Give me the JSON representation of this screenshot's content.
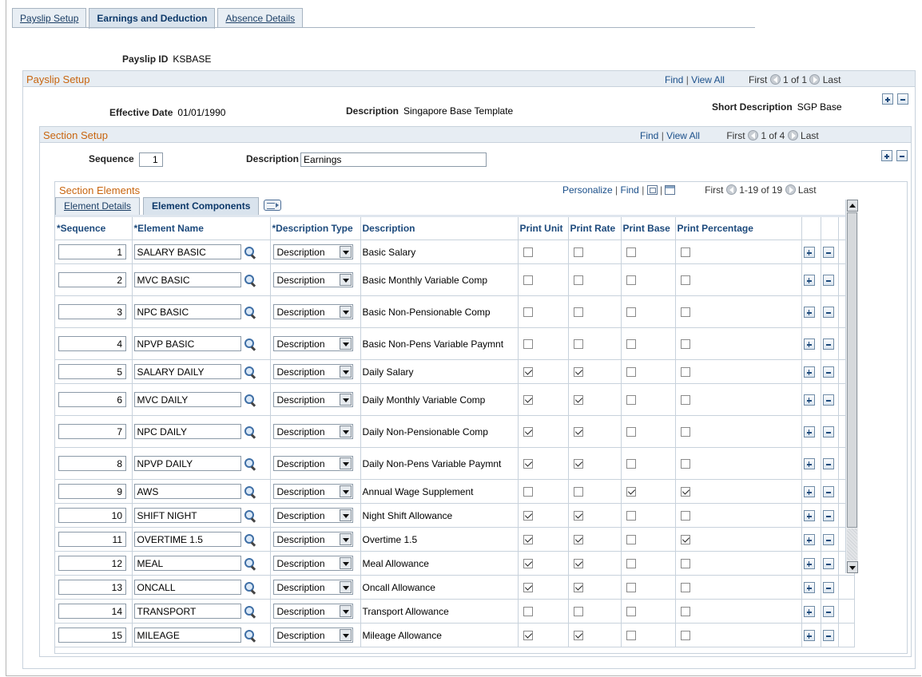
{
  "tabs": [
    {
      "pre": "",
      "u": "P",
      "post": "ayslip Setup"
    },
    {
      "pre": "",
      "u": "",
      "post": "Earnings and Deduction"
    },
    {
      "pre": "A",
      "u": "b",
      "post": "sence Details"
    }
  ],
  "payslip": {
    "id_label": "Payslip ID",
    "id_value": "KSBASE"
  },
  "payslip_setup": {
    "title": "Payslip Setup",
    "find": "Find",
    "sep": "|",
    "view_all": "View All",
    "first": "First",
    "count": "1 of 1",
    "last": "Last",
    "effective_date_label": "Effective Date",
    "effective_date": "01/01/1990",
    "description_label": "Description",
    "description": "Singapore Base Template",
    "short_description_label": "Short Description",
    "short_description": "SGP Base"
  },
  "section_setup": {
    "title": "Section Setup",
    "find": "Find",
    "sep": "|",
    "view_all": "View All",
    "first": "First",
    "count": "1 of 4",
    "last": "Last",
    "sequence_label": "Sequence",
    "sequence": "1",
    "description_label": "Description",
    "description": "Earnings"
  },
  "section_elements": {
    "title": "Section Elements",
    "personalize": "Personalize",
    "sep": "|",
    "find": "Find",
    "first": "First",
    "count": "1-19 of 19",
    "last": "Last",
    "subtabs": [
      {
        "u": "E",
        "post": "lement Details"
      },
      {
        "u": "",
        "post": "Element Components"
      }
    ],
    "columns": [
      "*Sequence",
      "*Element Name",
      "*Description Type",
      "Description",
      "Print Unit",
      "Print Rate",
      "Print Base",
      "Print Percentage"
    ],
    "rows": [
      {
        "seq": "1",
        "name": "SALARY BASIC",
        "dtype": "Description",
        "desc": "Basic Salary",
        "unit": false,
        "rate": false,
        "base": false,
        "pct": false,
        "h": 30
      },
      {
        "seq": "2",
        "name": "MVC BASIC",
        "dtype": "Description",
        "desc": "Basic Monthly Variable Comp",
        "unit": false,
        "rate": false,
        "base": false,
        "pct": false,
        "h": 40
      },
      {
        "seq": "3",
        "name": "NPC BASIC",
        "dtype": "Description",
        "desc": "Basic Non-Pensionable Comp",
        "unit": false,
        "rate": false,
        "base": false,
        "pct": false,
        "h": 40
      },
      {
        "seq": "4",
        "name": "NPVP BASIC",
        "dtype": "Description",
        "desc": "Basic Non-Pens Variable Paymnt",
        "unit": false,
        "rate": false,
        "base": false,
        "pct": false,
        "h": 40
      },
      {
        "seq": "5",
        "name": "SALARY DAILY",
        "dtype": "Description",
        "desc": "Daily Salary",
        "unit": true,
        "rate": true,
        "base": false,
        "pct": false,
        "h": 30
      },
      {
        "seq": "6",
        "name": "MVC DAILY",
        "dtype": "Description",
        "desc": "Daily Monthly Variable Comp",
        "unit": true,
        "rate": true,
        "base": false,
        "pct": false,
        "h": 40
      },
      {
        "seq": "7",
        "name": "NPC DAILY",
        "dtype": "Description",
        "desc": "Daily Non-Pensionable Comp",
        "unit": true,
        "rate": true,
        "base": false,
        "pct": false,
        "h": 40
      },
      {
        "seq": "8",
        "name": "NPVP DAILY",
        "dtype": "Description",
        "desc": "Daily Non-Pens Variable Paymnt",
        "unit": true,
        "rate": true,
        "base": false,
        "pct": false,
        "h": 40
      },
      {
        "seq": "9",
        "name": "AWS",
        "dtype": "Description",
        "desc": "Annual Wage Supplement",
        "unit": false,
        "rate": false,
        "base": true,
        "pct": true,
        "h": 30
      },
      {
        "seq": "10",
        "name": "SHIFT NIGHT",
        "dtype": "Description",
        "desc": "Night Shift Allowance",
        "unit": true,
        "rate": true,
        "base": false,
        "pct": false,
        "h": 30
      },
      {
        "seq": "11",
        "name": "OVERTIME 1.5",
        "dtype": "Description",
        "desc": "Overtime 1.5",
        "unit": true,
        "rate": true,
        "base": false,
        "pct": true,
        "h": 30
      },
      {
        "seq": "12",
        "name": "MEAL",
        "dtype": "Description",
        "desc": "Meal Allowance",
        "unit": true,
        "rate": true,
        "base": false,
        "pct": false,
        "h": 30
      },
      {
        "seq": "13",
        "name": "ONCALL",
        "dtype": "Description",
        "desc": "Oncall Allowance",
        "unit": true,
        "rate": true,
        "base": false,
        "pct": false,
        "h": 30
      },
      {
        "seq": "14",
        "name": "TRANSPORT",
        "dtype": "Description",
        "desc": "Transport Allowance",
        "unit": false,
        "rate": false,
        "base": false,
        "pct": false,
        "h": 30
      },
      {
        "seq": "15",
        "name": "MILEAGE",
        "dtype": "Description",
        "desc": "Mileage Allowance",
        "unit": true,
        "rate": true,
        "base": false,
        "pct": false,
        "h": 30
      }
    ]
  }
}
